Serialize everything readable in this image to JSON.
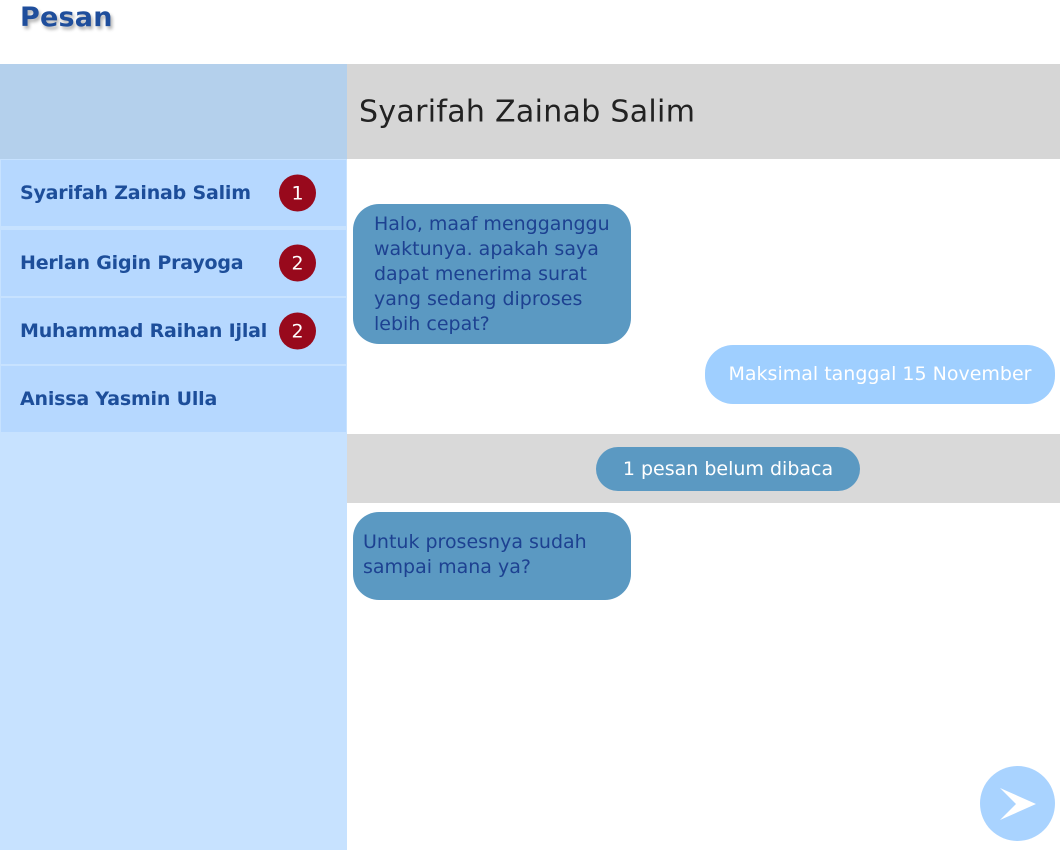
{
  "page": {
    "title": "Pesan"
  },
  "sidebar": {
    "contacts": [
      {
        "name": "Syarifah Zainab Salim",
        "badge": "1"
      },
      {
        "name": "Herlan Gigin Prayoga",
        "badge": "2"
      },
      {
        "name": "Muhammad Raihan Ijlal",
        "badge": "2"
      },
      {
        "name": "Anissa Yasmin Ulla",
        "badge": ""
      }
    ]
  },
  "chat": {
    "header_name": "Syarifah Zainab Salim",
    "messages": [
      {
        "direction": "incoming",
        "lines": [
          "Halo, maaf mengganggu",
          "waktunya. apakah saya",
          "dapat menerima surat",
          "yang sedang diproses",
          "lebih cepat?"
        ]
      },
      {
        "direction": "outgoing",
        "text": "Maksimal tanggal 15 November"
      },
      {
        "direction": "incoming",
        "lines": [
          "Untuk prosesnya sudah",
          "sampai mana ya?"
        ]
      }
    ],
    "unread_notice": "1 pesan belum dibaca",
    "send_icon": "chevron-right-icon"
  },
  "colors": {
    "title": "#1f4e9c",
    "sidebar_bg": "#c7e2ff",
    "sidebar_header": "#b4d0ec",
    "contact_bg": "#b6d8ff",
    "badge": "#98091c",
    "incoming_bubble": "#5b99c2",
    "outgoing_bubble": "#9fcfff",
    "chat_header": "#d6d6d6",
    "send_button": "#a9d3ff"
  }
}
